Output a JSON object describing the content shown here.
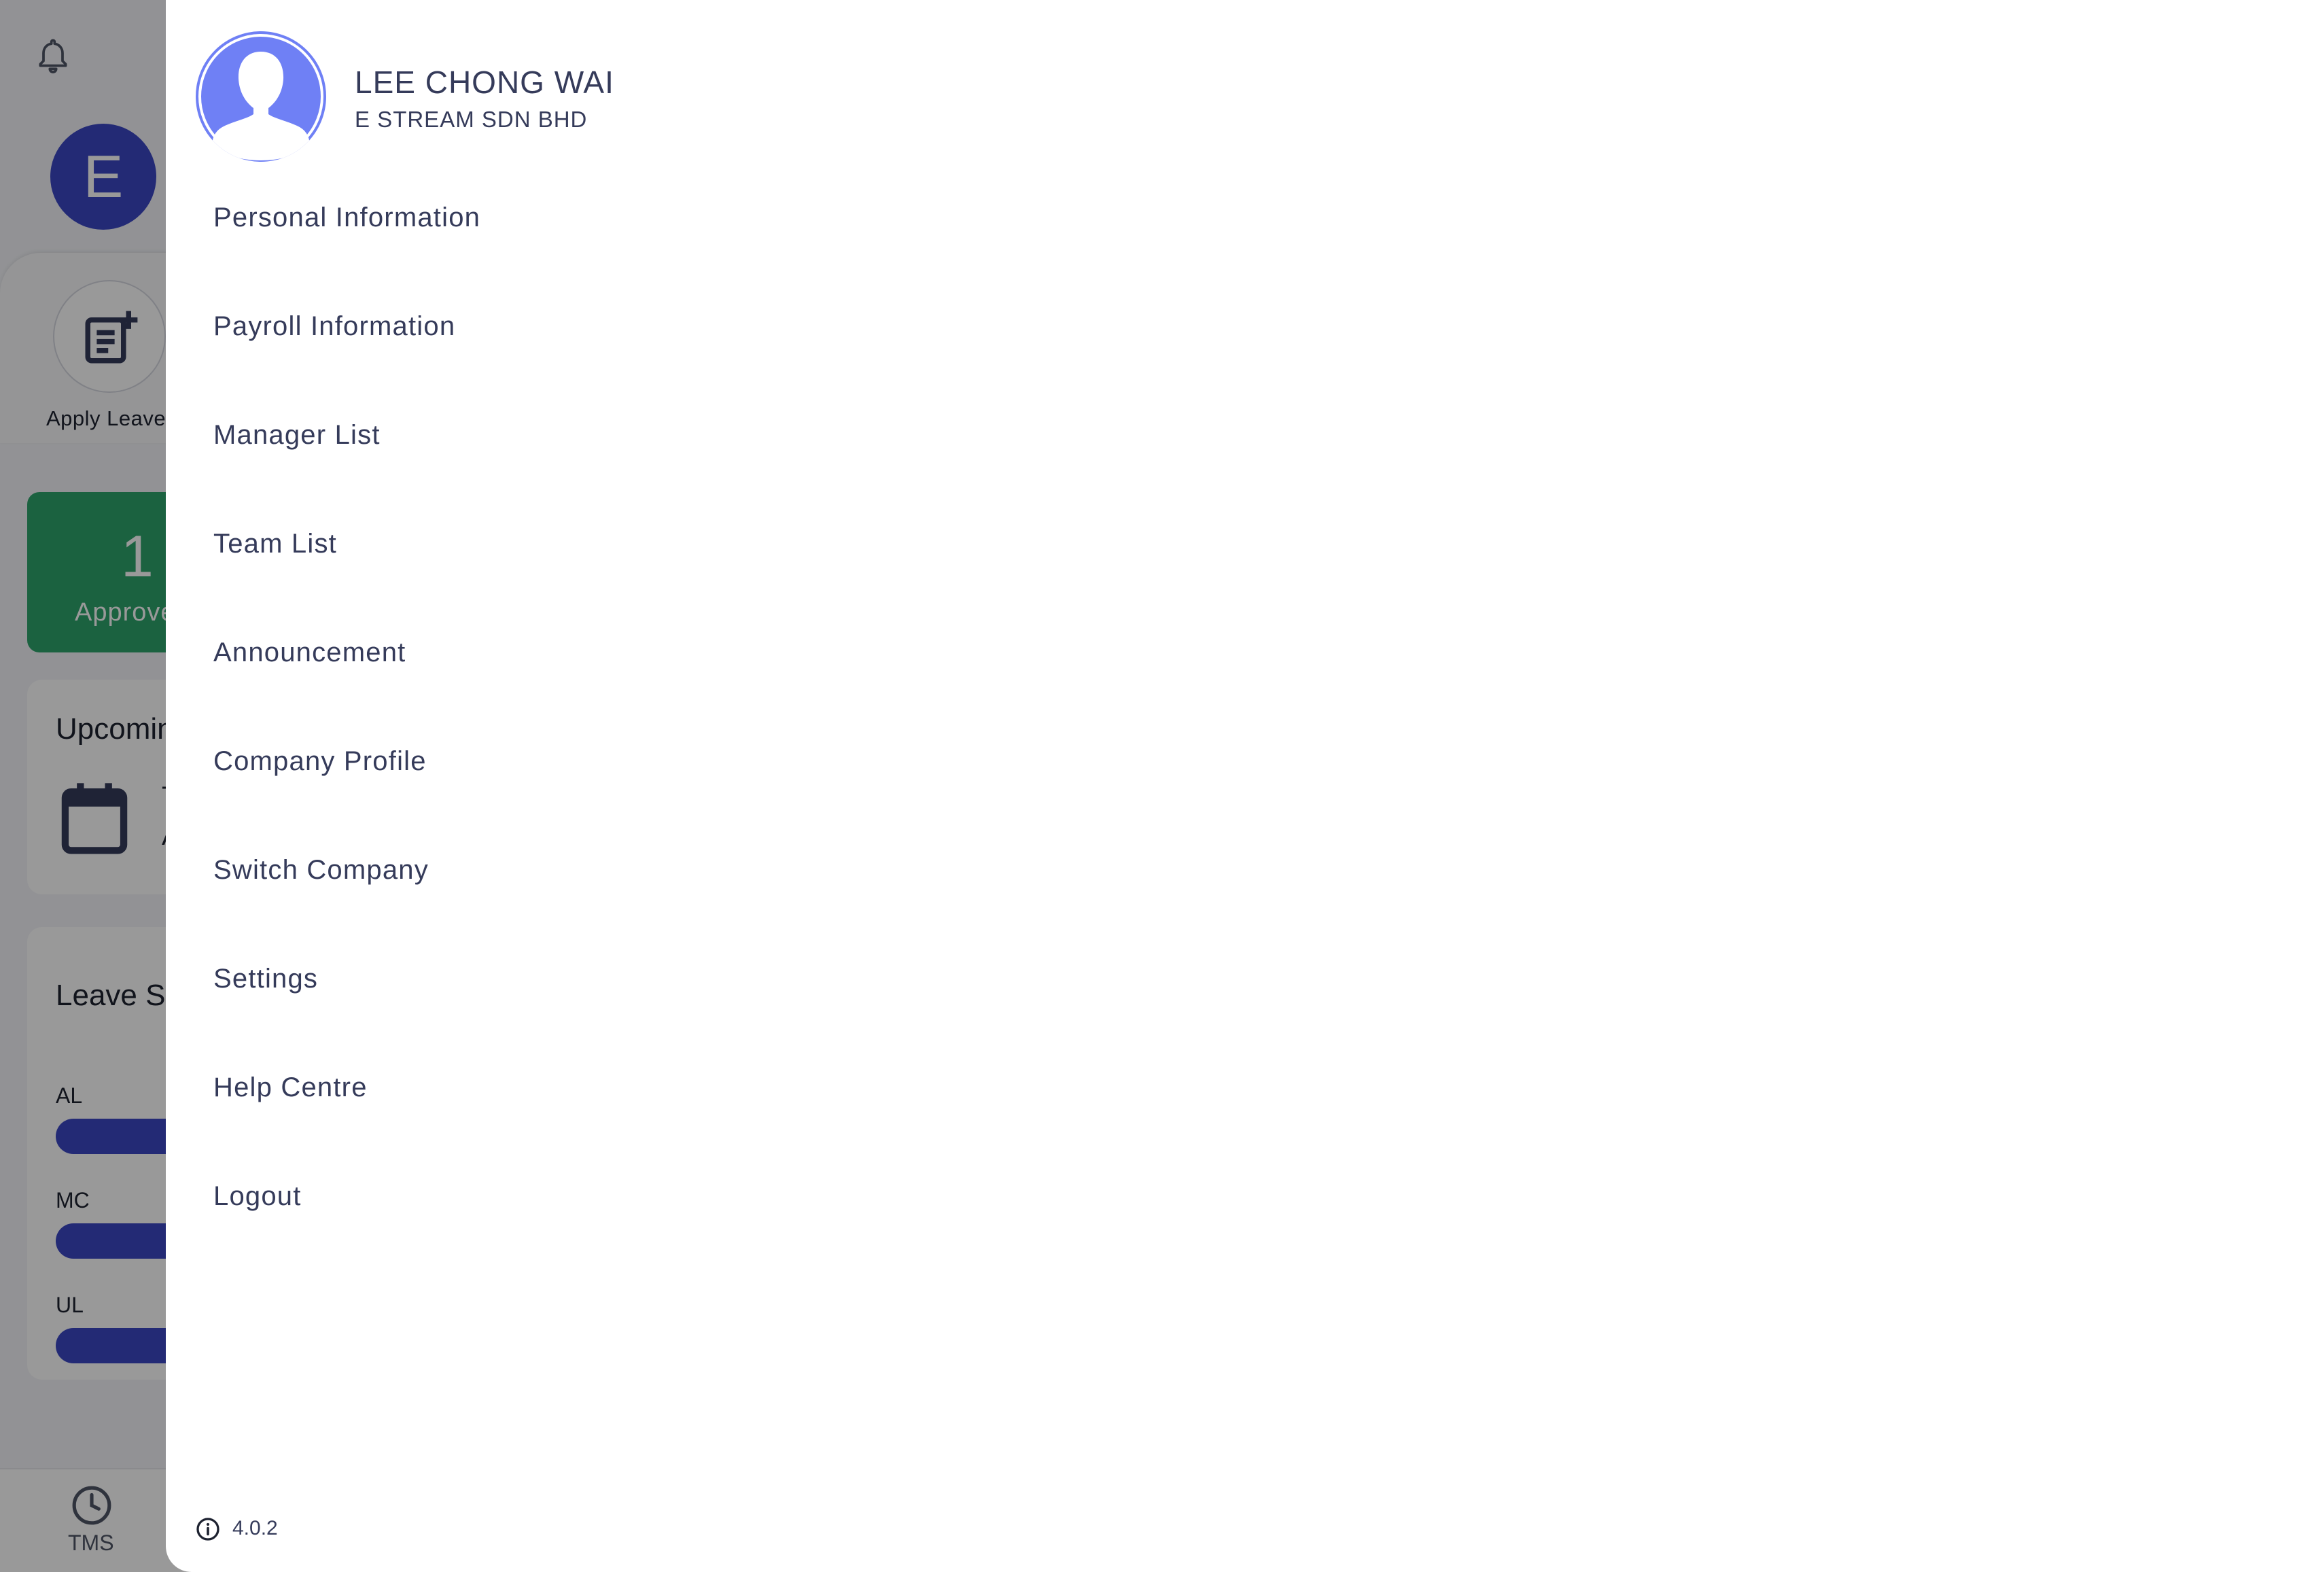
{
  "background": {
    "bell_icon": "bell-icon",
    "avatar_initial": "E",
    "quick_actions": {
      "apply_leave_label": "Apply Leave",
      "icon": "post-add-icon"
    },
    "approved": {
      "count": "1",
      "label": "Approved",
      "color": "#2ea36b"
    },
    "upcoming": {
      "title": "Upcoming",
      "icon": "calendar-icon",
      "line1": "T",
      "line2": "A"
    },
    "leave_summary": {
      "title": "Leave Summary",
      "items": [
        {
          "code": "AL"
        },
        {
          "code": "MC"
        },
        {
          "code": "UL"
        }
      ],
      "bar_color": "#3b47c4"
    },
    "bottom_nav": {
      "tms_label": "TMS",
      "tms_icon": "clock-icon"
    }
  },
  "drawer": {
    "user": {
      "name": "LEE CHONG WAI",
      "company": "E STREAM SDN BHD",
      "avatar_color": "#6f80f5"
    },
    "menu": [
      {
        "label": "Personal Information"
      },
      {
        "label": "Payroll Information"
      },
      {
        "label": "Manager List"
      },
      {
        "label": "Team List"
      },
      {
        "label": "Announcement"
      },
      {
        "label": "Company Profile"
      },
      {
        "label": "Switch Company"
      },
      {
        "label": "Settings"
      },
      {
        "label": "Help Centre"
      },
      {
        "label": "Logout"
      }
    ],
    "version": "4.0.2",
    "version_icon": "info-icon"
  },
  "colors": {
    "accent": "#3b47c4",
    "text": "#353b5a"
  }
}
